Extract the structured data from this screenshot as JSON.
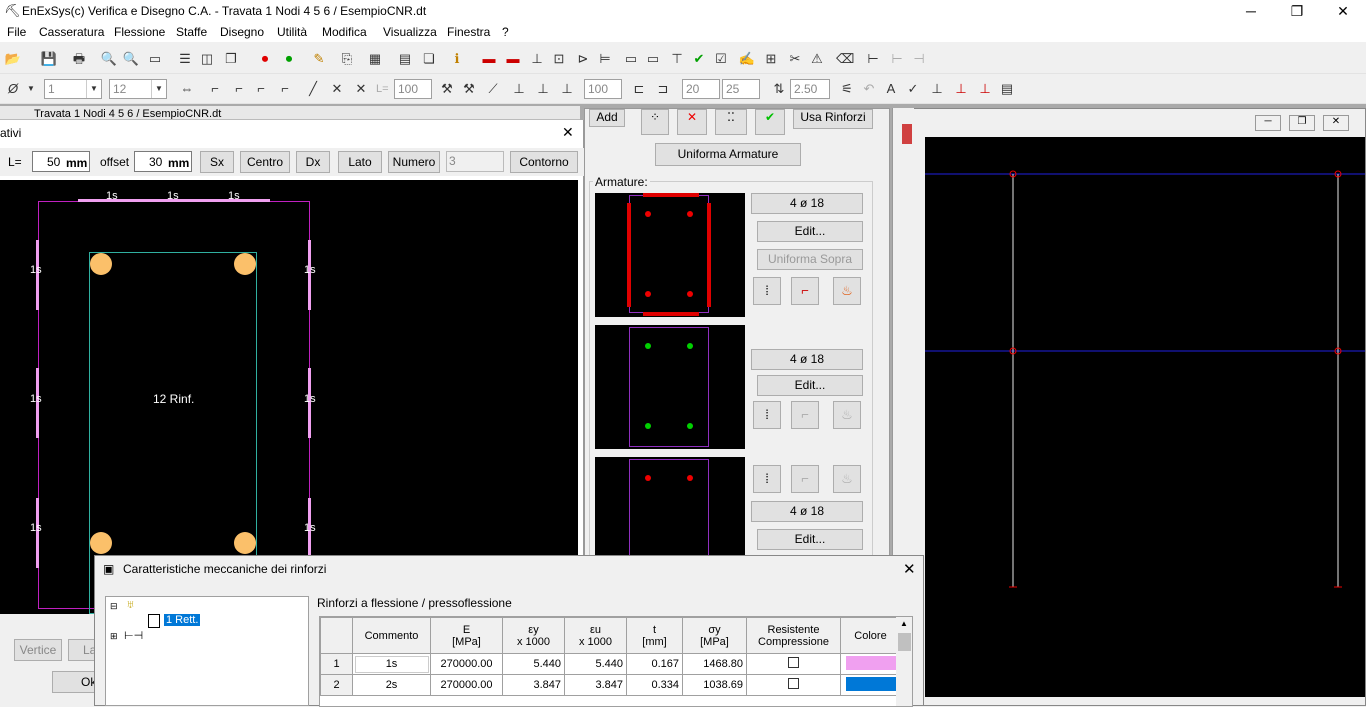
{
  "app": {
    "title": "EnExSys(c) Verifica e Disegno C.A. - Travata 1 Nodi 4 5 6 / EsempioCNR.dt",
    "controls": {
      "minimize": "─",
      "restore": "❐",
      "close": "✕"
    }
  },
  "menu": [
    "File",
    "Casseratura",
    "Flessione",
    "Staffe",
    "Disegno",
    "Utilità",
    "Modifica",
    "Visualizza",
    "Finestra",
    "?"
  ],
  "toolbar2": {
    "phi": "Ø",
    "combo1": "1",
    "combo2": "12",
    "len_label": "L=",
    "len_value": "100",
    "field1": "100",
    "field2": "20",
    "field3": "25",
    "field4": "2.50"
  },
  "back_window": {
    "title": "Travata 1 Nodi 4 5 6 / EsempioCNR.dt"
  },
  "rinforzi_window": {
    "title": "ativi",
    "len_label": "L=",
    "len_value": "50",
    "len_unit": "mm",
    "offset_label": "offset",
    "offset_value": "30",
    "offset_unit": "mm",
    "buttons": [
      "Sx",
      "Centro",
      "Dx",
      "Lato",
      "Numero"
    ],
    "numero_value": "3",
    "contorno": "Contorno",
    "top_labels": [
      "1s",
      "1s",
      "1s"
    ],
    "side_label": "1s",
    "center_label": "12 Rinf.",
    "vertice": "Vertice",
    "la": "La",
    "ok": "Ok"
  },
  "armature_panel": {
    "top_buttons": [
      "Add",
      "Usa Rinforzi"
    ],
    "uniforma_armature": "Uniforma Armature",
    "group_label": "Armature:",
    "sections": [
      {
        "bars": "4 ø 18",
        "edit": "Edit...",
        "extra": "Uniforma Sopra"
      },
      {
        "bars": "4 ø 18",
        "edit": "Edit..."
      },
      {
        "bars": "4 ø 18",
        "edit": "Edit..."
      }
    ]
  },
  "caratteristiche": {
    "title": "Caratteristiche meccaniche dei rinforzi",
    "tree_item": "1 Rett.",
    "section_label": "Rinforzi a flessione / pressoflessione",
    "headers": [
      "Commento",
      "E\n[MPa]",
      "εy\nx 1000",
      "εu\nx 1000",
      "t\n[mm]",
      "σy\n[MPa]",
      "Resistente\nCompressione",
      "Colore"
    ],
    "rows": [
      {
        "n": "1",
        "commento": "1s",
        "E": "270000.00",
        "ey": "5.440",
        "eu": "5.440",
        "t": "0.167",
        "sy": "1468.80",
        "color": "#f0a0f0"
      },
      {
        "n": "2",
        "commento": "2s",
        "E": "270000.00",
        "ey": "3.847",
        "eu": "3.847",
        "t": "0.334",
        "sy": "1038.69",
        "color": "#0078d7"
      }
    ]
  },
  "colors": {
    "pink": "#f0a0f0",
    "accent": "#0078d7",
    "red": "#e00000",
    "green": "#00d000"
  }
}
